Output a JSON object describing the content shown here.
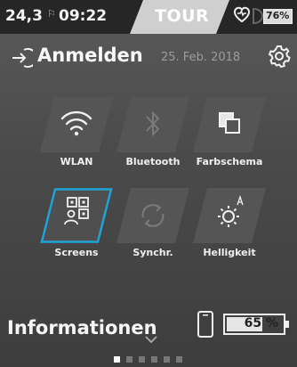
{
  "status_bar": {
    "speed": "24,3",
    "time": "09:22",
    "mode": "TOUR",
    "battery": "76%",
    "icons": [
      "flag-icon",
      "heart-icon",
      "light-icon",
      "battery-icon"
    ]
  },
  "header": {
    "title": "Anmelden",
    "date": "25. Feb. 2018",
    "icons": [
      "login-icon",
      "gear-icon"
    ]
  },
  "tiles": [
    {
      "label": "WLAN",
      "icon": "wifi-icon",
      "active": true
    },
    {
      "label": "Bluetooth",
      "icon": "bluetooth-icon",
      "active": false
    },
    {
      "label": "Farbschema",
      "icon": "color-scheme-icon",
      "active": true
    },
    {
      "label": "Screens",
      "icon": "screens-icon",
      "active": true,
      "selected": true
    },
    {
      "label": "Synchr.",
      "icon": "sync-icon",
      "active": false
    },
    {
      "label": "Helligkeit",
      "icon": "brightness-icon",
      "active": true
    }
  ],
  "footer": {
    "section": "Informationen",
    "ebike_battery": "65 %",
    "ebike_battery_level": 0.65,
    "page_count": 6,
    "current_page": 1
  },
  "colors": {
    "accent": "#1fa3d6",
    "background": "#4b4b4b",
    "statusbar": "#262626"
  }
}
